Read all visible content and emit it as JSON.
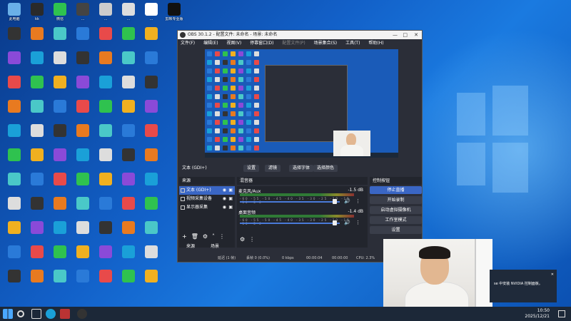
{
  "desktop": {
    "icons": [
      {
        "label": "此电脑",
        "color": "#6ab0e8"
      },
      {
        "label": "kk",
        "color": "#2a2a2a"
      },
      {
        "label": "微信",
        "color": "#2fc24f"
      },
      {
        "label": "...",
        "color": "#444"
      },
      {
        "label": "...",
        "color": "#ccc"
      },
      {
        "label": "...",
        "color": "#ddd"
      },
      {
        "label": "...",
        "color": "#fff"
      },
      {
        "label": "剪映专业版",
        "color": "#111"
      }
    ]
  },
  "obs": {
    "title": "OBS 30.1.2 - 配置文件: 未命名 - 场景: 未命名",
    "menu": [
      "文件(F)",
      "编辑(E)",
      "视图(V)",
      "停靠窗口(D)",
      "配置文件(P)",
      "场景集合(S)",
      "工具(T)",
      "帮助(H)"
    ],
    "source_toolbar": {
      "label": "文本 (GDI+)",
      "buttons": [
        "设置",
        "滤镜",
        "选择字体",
        "选择颜色"
      ]
    },
    "sources": {
      "title": "来源",
      "items": [
        {
          "name": "文本 (GDI+)",
          "selected": true
        },
        {
          "name": "视频采集设备",
          "selected": false
        },
        {
          "name": "显示器采集",
          "selected": false
        }
      ],
      "tabs": [
        "来源",
        "场景"
      ]
    },
    "mixer": {
      "title": "混音器",
      "tracks": [
        {
          "name": "麦克风/Aux",
          "db": "-1.5 dB",
          "scale": "-60 -55 -50 -45 -40 -35 -30 -25 -20 -15 -10 -5 0"
        },
        {
          "name": "桌面音频",
          "db": "-1.4 dB",
          "scale": "-60 -55 -50 -45 -40 -35 -30 -25 -20 -15 -10 -5 0"
        }
      ]
    },
    "controls": {
      "title": "控制按钮",
      "buttons": [
        "停止直播",
        "开始录制",
        "启动虚拟摄像机",
        "工作室模式",
        "设置"
      ]
    },
    "status": {
      "dropped": "延迟 (1 帧)",
      "frames": "丢帧 0 (0.0%)",
      "bitrate": "0 kbps",
      "live_time": "00:00:04",
      "rec_time": "00:00:00",
      "cpu": "CPU: 2.3%"
    }
  },
  "taskbar": {
    "time": "10:50",
    "date": "2025/12/21"
  },
  "notification": {
    "text": "se 中安装 NVIDIA 控制面板。"
  },
  "colors": {
    "accent": "#3a66c4",
    "obs_bg": "#2b2e38",
    "dock_bg": "#22252d"
  }
}
